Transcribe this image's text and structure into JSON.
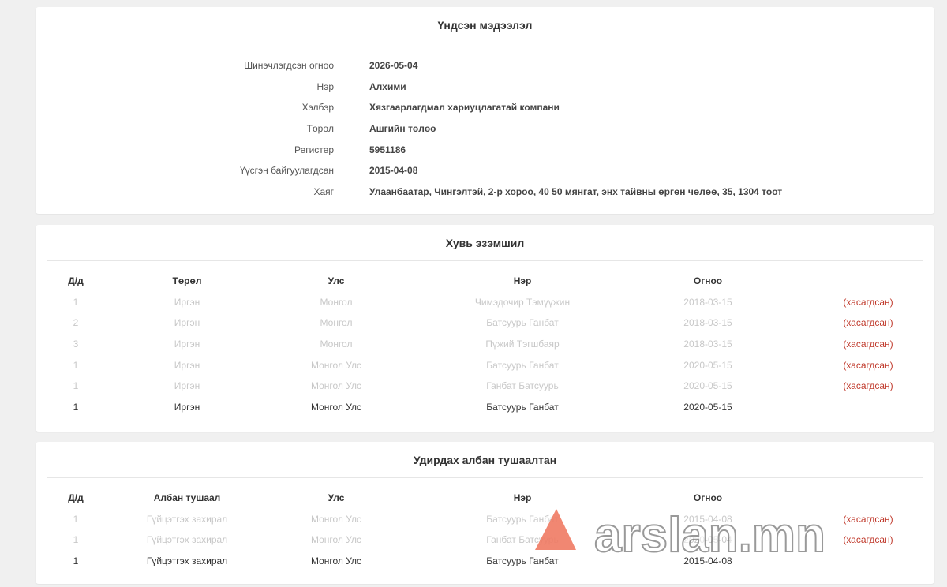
{
  "basic_info": {
    "title": "Үндсэн мэдээлэл",
    "rows": [
      {
        "label": "Шинэчлэгдсэн огноо",
        "value": "2026-05-04"
      },
      {
        "label": "Нэр",
        "value": "Алхими"
      },
      {
        "label": "Хэлбэр",
        "value": "Хязгаарлагдмал хариуцлагатай компани"
      },
      {
        "label": "Төрөл",
        "value": "Ашгийн төлөө"
      },
      {
        "label": "Регистер",
        "value": "5951186"
      },
      {
        "label": "Үүсгэн байгуулагдсан",
        "value": "2015-04-08"
      },
      {
        "label": "Хаяг",
        "value": "Улаанбаатар, Чингэлтэй, 2-р хороо, 40 50 мянгат, энх тайвны өргөн чөлөө, 35, 1304 тоот"
      }
    ]
  },
  "ownership": {
    "title": "Хувь эзэмшил",
    "headers": [
      "Д/д",
      "Төрөл",
      "Улс",
      "Нэр",
      "Огноо"
    ],
    "rows": [
      {
        "no": "1",
        "type": "Иргэн",
        "country": "Монгол",
        "name": "Чимэдочир Тэмүүжин",
        "date": "2018-03-15",
        "status": "(хасагдсан)"
      },
      {
        "no": "2",
        "type": "Иргэн",
        "country": "Монгол",
        "name": "Батсуурь Ганбат",
        "date": "2018-03-15",
        "status": "(хасагдсан)"
      },
      {
        "no": "3",
        "type": "Иргэн",
        "country": "Монгол",
        "name": "Пүжий Тэгшбаяр",
        "date": "2018-03-15",
        "status": "(хасагдсан)"
      },
      {
        "no": "1",
        "type": "Иргэн",
        "country": "Монгол Улс",
        "name": "Батсуурь Ганбат",
        "date": "2020-05-15",
        "status": "(хасагдсан)"
      },
      {
        "no": "1",
        "type": "Иргэн",
        "country": "Монгол Улс",
        "name": "Ганбат Батсуурь",
        "date": "2020-05-15",
        "status": "(хасагдсан)"
      },
      {
        "no": "1",
        "type": "Иргэн",
        "country": "Монгол Улс",
        "name": "Батсуурь Ганбат",
        "date": "2020-05-15",
        "status": ""
      }
    ]
  },
  "officers": {
    "title": "Удирдах албан тушаалтан",
    "headers": [
      "Д/д",
      "Албан тушаал",
      "Улс",
      "Нэр",
      "Огноо"
    ],
    "rows": [
      {
        "no": "1",
        "position": "Гүйцэтгэх захирал",
        "country": "Монгол Улс",
        "name": "Батсуурь Ганбат",
        "date": "2015-04-08",
        "status": "(хасагдсан)"
      },
      {
        "no": "1",
        "position": "Гүйцэтгэх захирал",
        "country": "Монгол Улс",
        "name": "Ганбат Батсуурь",
        "date": "2020-05-04",
        "status": "(хасагдсан)"
      },
      {
        "no": "1",
        "position": "Гүйцэтгэх захирал",
        "country": "Монгол Улс",
        "name": "Батсуурь Ганбат",
        "date": "2015-04-08",
        "status": ""
      }
    ]
  },
  "watermark": {
    "text": "arslan.mn"
  },
  "colors": {
    "removed_status": "#c0392b",
    "inactive_text": "#c8c8c8",
    "watermark_accent": "#f07a63"
  }
}
